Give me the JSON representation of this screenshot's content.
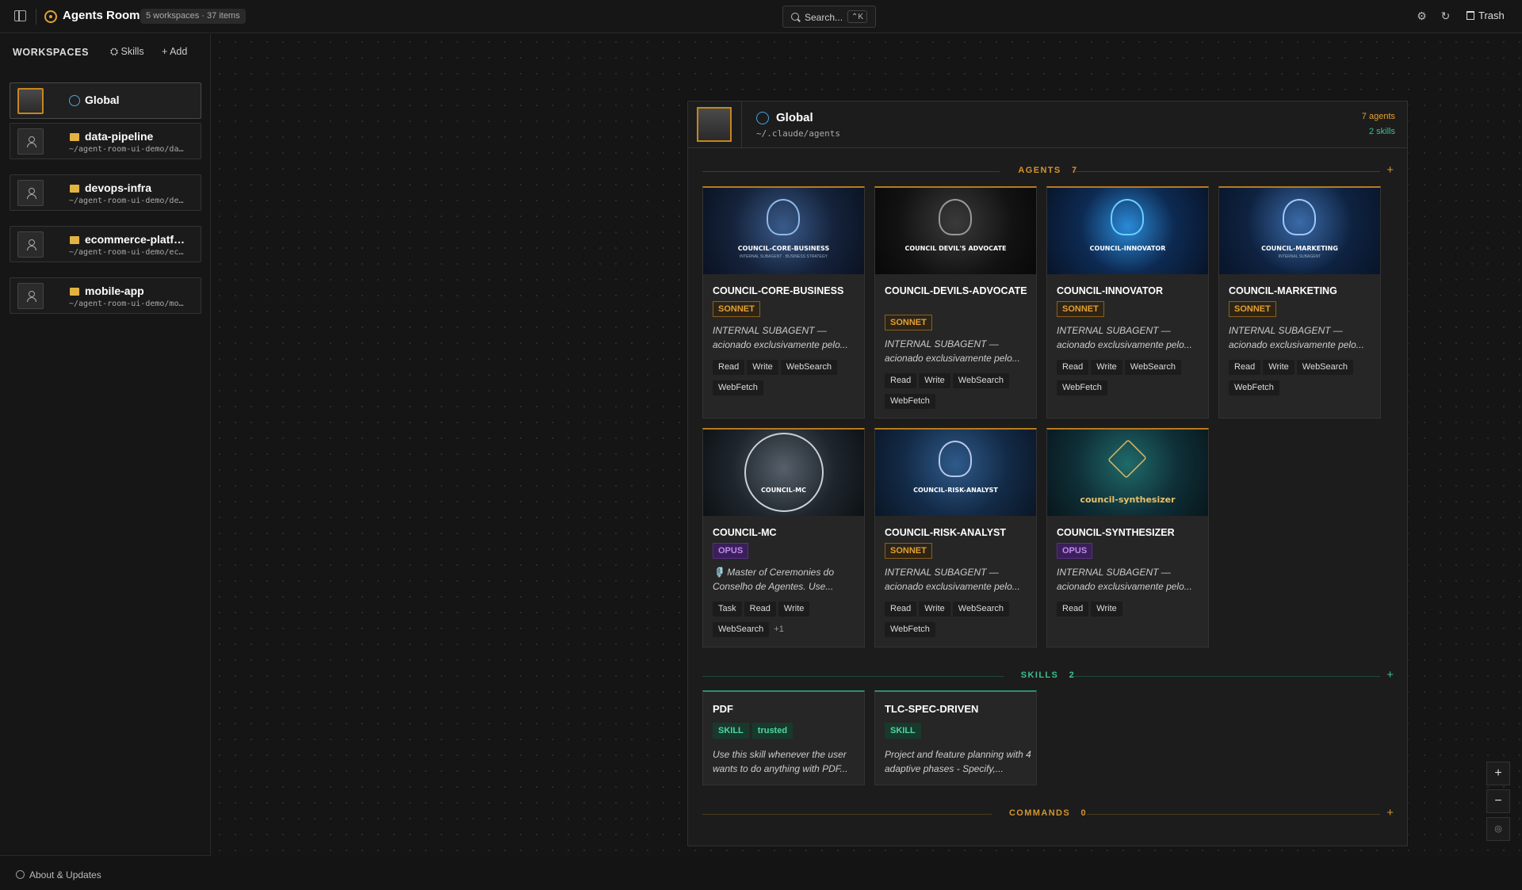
{
  "app": {
    "title": "Agents Room",
    "summary": "5 workspaces · 37 items"
  },
  "search": {
    "placeholder": "Search...",
    "shortcut": "⌃K"
  },
  "toolbar": {
    "trash_label": "Trash"
  },
  "sidebar": {
    "heading": "WORKSPACES",
    "skills_label": "Skills",
    "add_label": "Add",
    "about_label": "About & Updates",
    "workspaces": [
      {
        "name": "Global",
        "path": ""
      },
      {
        "name": "data-pipeline",
        "path": "~/agent-room-ui-demo/da…"
      },
      {
        "name": "devops-infra",
        "path": "~/agent-room-ui-demo/de…"
      },
      {
        "name": "ecommerce-platf…",
        "path": "~/agent-room-ui-demo/ec…"
      },
      {
        "name": "mobile-app",
        "path": "~/agent-room-ui-demo/mo…"
      }
    ]
  },
  "workspace": {
    "title": "Global",
    "path": "~/.claude/agents",
    "agents_count_label": "7 agents",
    "skills_count_label": "2 skills",
    "sections": {
      "agents": {
        "label": "AGENTS",
        "count": "7",
        "plus": "+"
      },
      "skills": {
        "label": "SKILLS",
        "count": "2",
        "plus": "+"
      },
      "commands": {
        "label": "COMMANDS",
        "count": "0",
        "plus": "+"
      }
    },
    "agents": [
      {
        "name": "COUNCIL-CORE-BUSINESS",
        "model": "SONNET",
        "desc": "INTERNAL SUBAGENT — acionado exclusivamente pelo...",
        "tools": [
          "Read",
          "Write",
          "WebSearch",
          "WebFetch"
        ],
        "more": "",
        "image_title": "COUNCIL-CORE-BUSINESS",
        "image_sub": "INTERNAL SUBAGENT · BUSINESS STRATEGY"
      },
      {
        "name": "COUNCIL-DEVILS-ADVOCATE",
        "model": "SONNET",
        "desc": "INTERNAL SUBAGENT — acionado exclusivamente pelo...",
        "tools": [
          "Read",
          "Write",
          "WebSearch",
          "WebFetch"
        ],
        "more": "",
        "image_title": "COUNCIL DEVIL'S ADVOCATE",
        "image_sub": ""
      },
      {
        "name": "COUNCIL-INNOVATOR",
        "model": "SONNET",
        "desc": "INTERNAL SUBAGENT — acionado exclusivamente pelo...",
        "tools": [
          "Read",
          "Write",
          "WebSearch",
          "WebFetch"
        ],
        "more": "",
        "image_title": "COUNCIL-INNOVATOR",
        "image_sub": ""
      },
      {
        "name": "COUNCIL-MARKETING",
        "model": "SONNET",
        "desc": "INTERNAL SUBAGENT — acionado exclusivamente pelo...",
        "tools": [
          "Read",
          "Write",
          "WebSearch",
          "WebFetch"
        ],
        "more": "",
        "image_title": "COUNCIL-MARKETING",
        "image_sub": "INTERNAL SUBAGENT"
      },
      {
        "name": "COUNCIL-MC",
        "model": "OPUS",
        "desc": "🎙️ Master of Ceremonies do Conselho de Agentes. Use...",
        "tools": [
          "Task",
          "Read",
          "Write",
          "WebSearch"
        ],
        "more": "+1",
        "image_title": "COUNCIL-MC",
        "image_sub": ""
      },
      {
        "name": "COUNCIL-RISK-ANALYST",
        "model": "SONNET",
        "desc": "INTERNAL SUBAGENT — acionado exclusivamente pelo...",
        "tools": [
          "Read",
          "Write",
          "WebSearch",
          "WebFetch"
        ],
        "more": "",
        "image_title": "COUNCIL-RISK-ANALYST",
        "image_sub": ""
      },
      {
        "name": "COUNCIL-SYNTHESIZER",
        "model": "OPUS",
        "desc": "INTERNAL SUBAGENT — acionado exclusivamente pelo...",
        "tools": [
          "Read",
          "Write"
        ],
        "more": "",
        "image_title": "council-synthesizer",
        "image_sub": ""
      }
    ],
    "skills": [
      {
        "name": "PDF",
        "badges": [
          "SKILL",
          "trusted"
        ],
        "desc": "Use this skill whenever the user wants to do anything with PDF..."
      },
      {
        "name": "TLC-SPEC-DRIVEN",
        "badges": [
          "SKILL"
        ],
        "desc": "Project and feature planning with 4 adaptive phases - Specify,..."
      }
    ]
  },
  "zoom": {
    "in": "+",
    "out": "−",
    "fit": "◎"
  },
  "colors": {
    "accent": "#e3a032",
    "skills": "#3fbf8f",
    "opus": "#c08af0"
  }
}
